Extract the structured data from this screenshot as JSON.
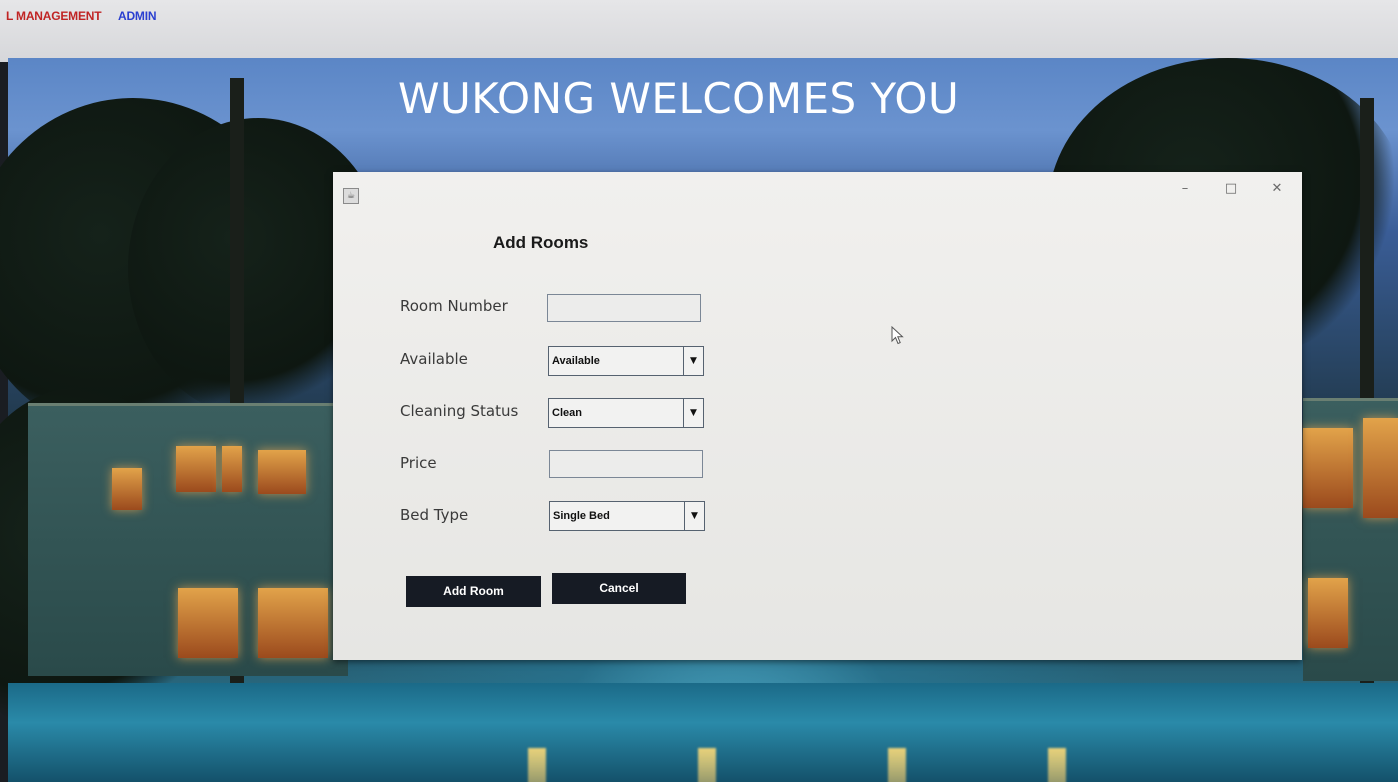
{
  "app_menu": {
    "management_label": "L MANAGEMENT",
    "admin_label": "ADMIN"
  },
  "background": {
    "welcome_text": "WUKONG WELCOMES YOU"
  },
  "dialog": {
    "title": "Add Rooms",
    "window_controls": {
      "minimize": "–",
      "maximize": "□",
      "close": "✕"
    },
    "fields": {
      "room_number": {
        "label": "Room Number",
        "value": ""
      },
      "available": {
        "label": "Available",
        "selected": "Available"
      },
      "cleaning_status": {
        "label": "Cleaning Status",
        "selected": "Clean"
      },
      "price": {
        "label": "Price",
        "value": ""
      },
      "bed_type": {
        "label": "Bed Type",
        "selected": "Single Bed"
      }
    },
    "buttons": {
      "add_room": "Add Room",
      "cancel": "Cancel"
    }
  },
  "colors": {
    "menu_management": "#c02424",
    "menu_admin": "#2a3fd0",
    "button_bg": "#161b24",
    "dialog_bg": "#efefed"
  },
  "icons": {
    "dialog_app_icon": "java-cup-icon",
    "combo_arrow": "triangle-down-icon",
    "cursor": "mouse-pointer-icon"
  }
}
